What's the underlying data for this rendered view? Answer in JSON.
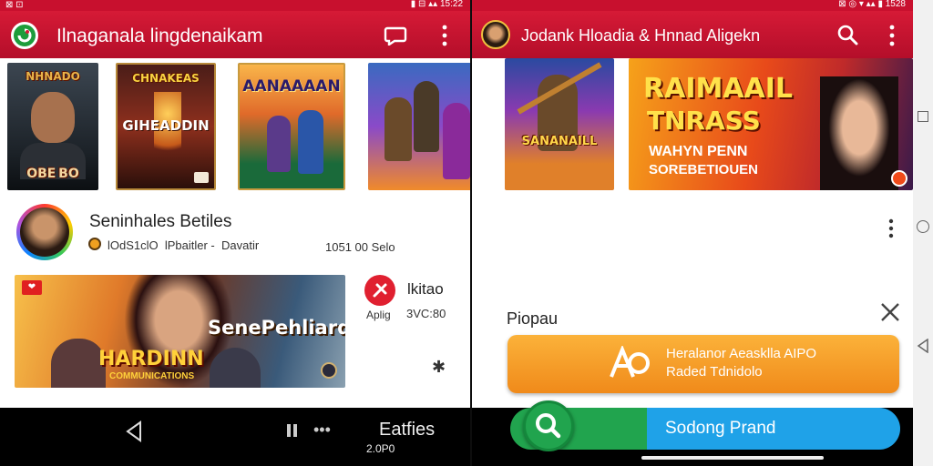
{
  "left": {
    "status_left": "⊠ ⊡",
    "status_right": "▮ ⊟ ▴▴ 15:22",
    "app_title": "Ilnaganala lingdenaikam",
    "thumbs": [
      {
        "caption_top": "NHNADO",
        "caption_bottom": "OBE BO"
      },
      {
        "caption_top": "CHNAKEAS",
        "caption_bottom": "GIHEADDIN"
      },
      {
        "caption_top": "AANAAAAN",
        "caption_bottom": ""
      },
      {
        "caption_top": "",
        "caption_bottom": ""
      }
    ],
    "channel": {
      "name": "Seninhales Betiles",
      "meta": "lOdS1clO  lPbaitler -  Davatir",
      "count": "1051 00 Selo"
    },
    "banner": {
      "badge": "❤",
      "title_line1": "SenePehliard",
      "title_line2": "HARDINN",
      "title_line3": "COMMUNICATIONS"
    },
    "side": {
      "label": "lkitao",
      "sub1": "Aplig",
      "sub2": "3VC:80"
    },
    "star": "✱",
    "nav": {
      "label": "Eatfies",
      "sub": "2.0P0"
    }
  },
  "right": {
    "status_right": "⊠ ◎ ▾ ▴▴ ▮ 1528",
    "app_title": "Jodank Hloadia & Hnnad Aligekn",
    "thumb1_caption": "SANANAILL",
    "hero": {
      "line1": "RAIMAAIL",
      "line2": "TNRASS",
      "line3": "WAHYN PENN",
      "line4": "SOREBETIOUEN"
    },
    "section_title": "Piopau",
    "promo": {
      "line1": "Heralanor Aeasklla AIPO",
      "line2": "Raded Tdnidolo"
    },
    "cta": {
      "label": "Sodong Prand"
    }
  },
  "colors": {
    "brand_red": "#c8102e",
    "accent_orange": "#f5a122",
    "accent_blue": "#1fa2e8",
    "accent_green": "#21a44e"
  },
  "icons": [
    "app-logo-icon",
    "chat-icon",
    "more-vert-icon",
    "search-icon",
    "close-icon",
    "back-icon",
    "recents-icon",
    "home-icon"
  ]
}
